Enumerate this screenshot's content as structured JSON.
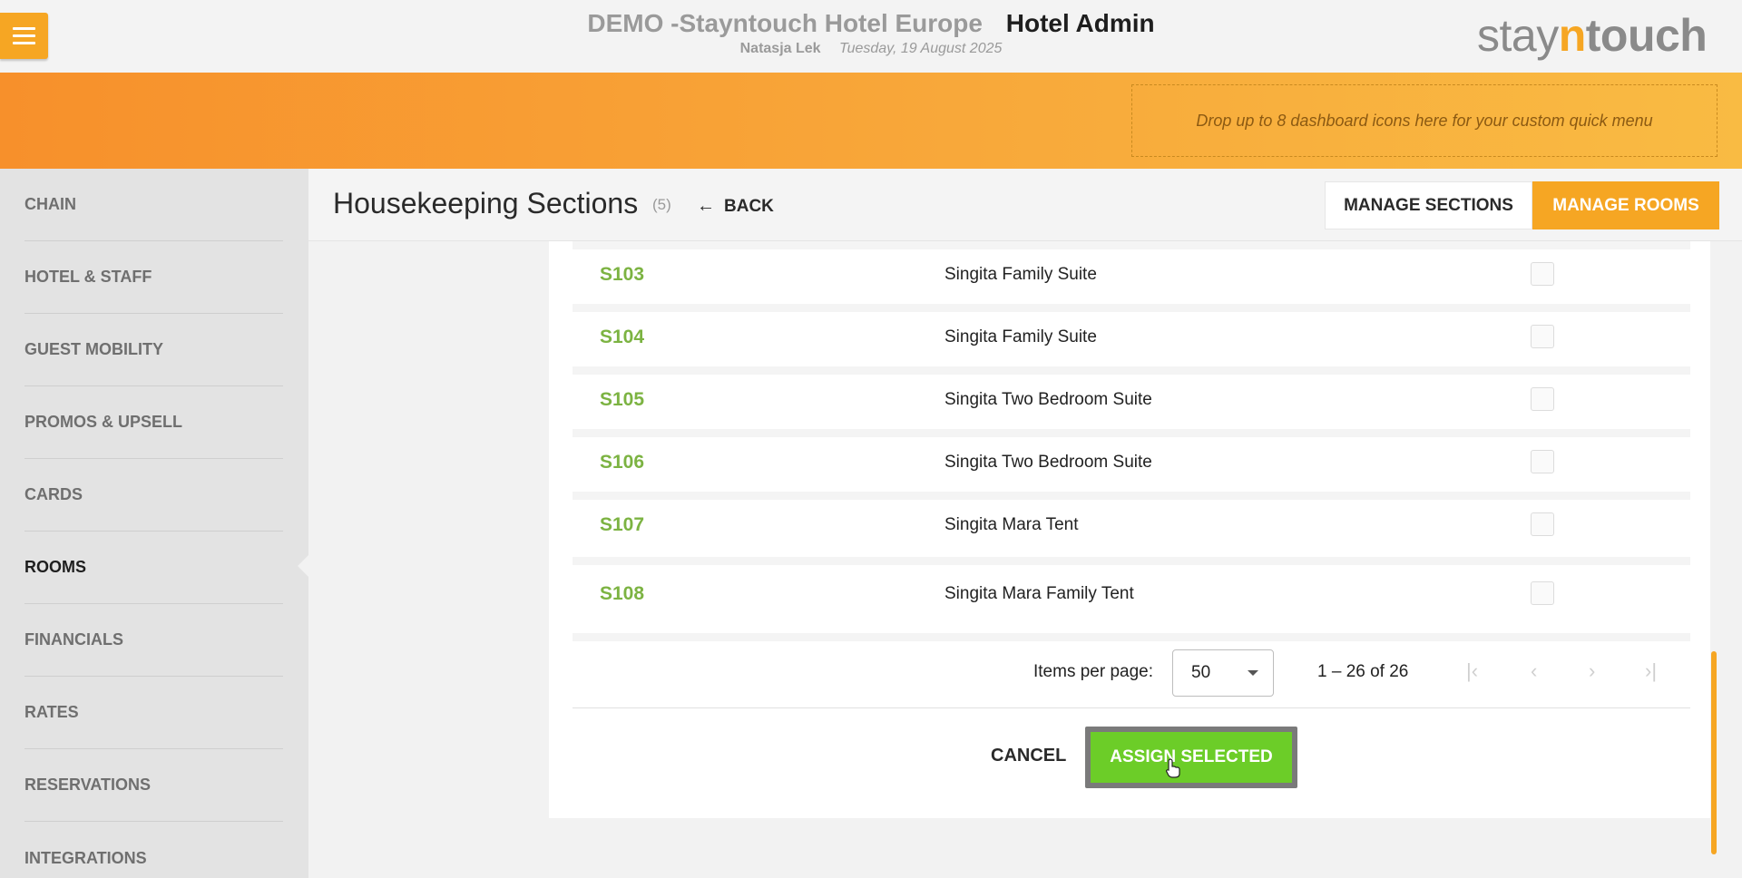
{
  "header": {
    "hotel_name": "DEMO -Stayntouch Hotel Europe",
    "app_name": "Hotel Admin",
    "user_name": "Natasja Lek",
    "date": "Tuesday, 19 August 2025",
    "logo": {
      "part1": "stay",
      "part2": "n",
      "part3": "touch"
    }
  },
  "banner": {
    "drop_hint": "Drop up to 8 dashboard icons here for your custom quick menu"
  },
  "sidebar": {
    "items": [
      {
        "label": "CHAIN"
      },
      {
        "label": "HOTEL & STAFF"
      },
      {
        "label": "GUEST MOBILITY"
      },
      {
        "label": "PROMOS & UPSELL"
      },
      {
        "label": "CARDS"
      },
      {
        "label": "ROOMS",
        "active": true
      },
      {
        "label": "FINANCIALS"
      },
      {
        "label": "RATES"
      },
      {
        "label": "RESERVATIONS"
      },
      {
        "label": "INTEGRATIONS"
      }
    ]
  },
  "page": {
    "title": "Housekeeping Sections",
    "count": "(5)",
    "back_label": "BACK",
    "manage_sections_label": "MANAGE SECTIONS",
    "manage_rooms_label": "MANAGE ROOMS"
  },
  "rooms": [
    {
      "number": "S103",
      "type": "Singita Family Suite",
      "checked": false
    },
    {
      "number": "S104",
      "type": "Singita Family Suite",
      "checked": false
    },
    {
      "number": "S105",
      "type": "Singita Two Bedroom Suite",
      "checked": false
    },
    {
      "number": "S106",
      "type": "Singita Two Bedroom Suite",
      "checked": false
    },
    {
      "number": "S107",
      "type": "Singita Mara Tent",
      "checked": false
    },
    {
      "number": "S108",
      "type": "Singita Mara Family Tent",
      "checked": false
    }
  ],
  "pagination": {
    "items_per_page_label": "Items per page:",
    "items_per_page": "50",
    "range": "1 – 26 of 26",
    "first": "|‹",
    "prev": "‹",
    "next": "›",
    "last": "›|"
  },
  "actions": {
    "cancel_label": "CANCEL",
    "assign_label": "ASSIGN SELECTED"
  },
  "colors": {
    "accent": "#f6a623",
    "room_number": "#7cb342",
    "assign_button": "#6ccd28"
  }
}
